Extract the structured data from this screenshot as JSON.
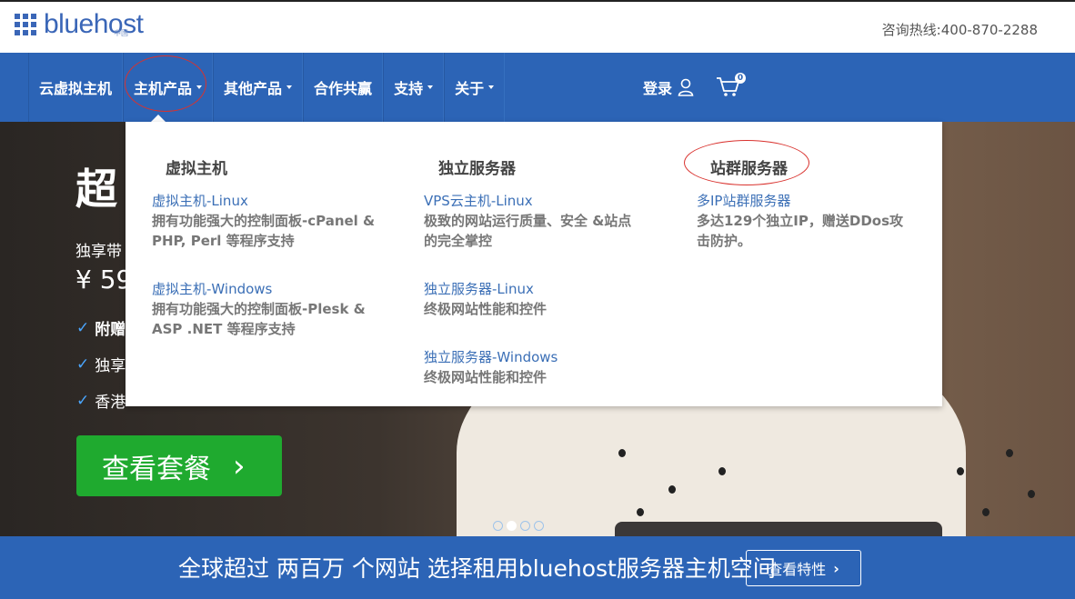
{
  "brand": {
    "name": "bluehost",
    "sub": "中国",
    "color": "#3a66b7"
  },
  "hotline": {
    "label": "咨询热线:",
    "number": "400-870-2288"
  },
  "nav": {
    "items": [
      {
        "label": "云虚拟主机",
        "caret": false
      },
      {
        "label": "主机产品",
        "caret": true
      },
      {
        "label": "其他产品",
        "caret": true
      },
      {
        "label": "合作共赢",
        "caret": false
      },
      {
        "label": "支持",
        "caret": true
      },
      {
        "label": "关于",
        "caret": true
      }
    ],
    "login": "登录",
    "cart_count": "0",
    "color": "#2c64b6"
  },
  "dropdown": {
    "columns": [
      {
        "title": "虚拟主机",
        "entries": [
          {
            "link": "虚拟主机-Linux",
            "desc": "拥有功能强大的控制面板-cPanel & PHP, Perl 等程序支持"
          },
          {
            "link": "虚拟主机-Windows",
            "desc": "拥有功能强大的控制面板-Plesk & ASP .NET 等程序支持"
          }
        ]
      },
      {
        "title": "独立服务器",
        "entries": [
          {
            "link": "VPS云主机-Linux",
            "desc": "极致的网站运行质量、安全 &站点的完全掌控"
          },
          {
            "link": "独立服务器-Linux",
            "desc": "终极网站性能和控件"
          },
          {
            "link": "独立服务器-Windows",
            "desc": "终极网站性能和控件"
          }
        ]
      },
      {
        "title": "站群服务器",
        "entries": [
          {
            "link": "多IP站群服务器",
            "desc": "多达129个独立IP，赠送DDos攻击防护。"
          }
        ]
      }
    ]
  },
  "hero": {
    "title": "超",
    "sub": "独享带",
    "price": "¥ 59",
    "features": [
      "附赠",
      "独享",
      "香港"
    ],
    "cta": "查看套餐"
  },
  "bottom": {
    "text": "全球超过 两百万 个网站 选择租用bluehost服务器主机空间",
    "button": "查看特性"
  }
}
